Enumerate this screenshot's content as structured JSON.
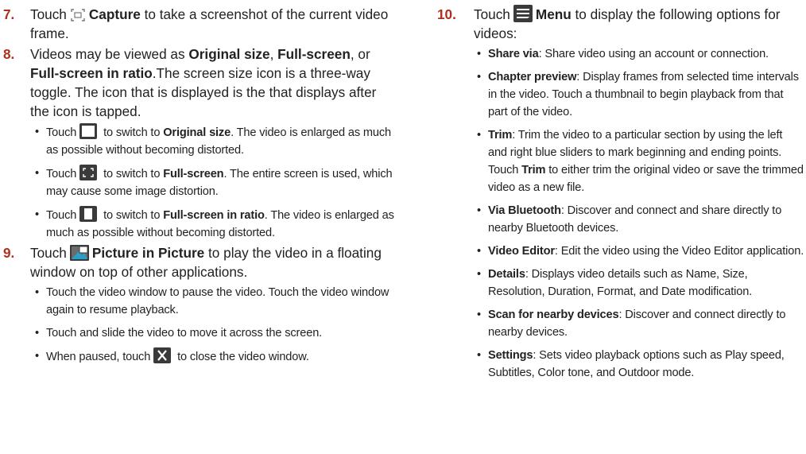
{
  "left": {
    "step7": {
      "num": "7.",
      "pre": "Touch",
      "icon": "capture-icon",
      "bold": "Capture",
      "post": " to take a screenshot of the current video frame."
    },
    "step8": {
      "num": "8.",
      "t1": "Videos may be viewed as ",
      "b1": "Original size",
      "t2": ", ",
      "b2": "Full-screen",
      "t3": ", or ",
      "b3": "Full-screen in ratio",
      "t4": ".The screen size icon is a three-way toggle. The icon that is displayed is the that displays after the icon is tapped.",
      "bullets": [
        {
          "pre": "Touch",
          "icon": "original-size-icon",
          "mid": " to switch to ",
          "bold": "Original size",
          "post": ". The video is enlarged as much as possible without becoming distorted."
        },
        {
          "pre": "Touch",
          "icon": "full-screen-icon",
          "mid": " to switch to ",
          "bold": "Full-screen",
          "post": ". The entire screen is used, which may cause some image distortion."
        },
        {
          "pre": "Touch",
          "icon": "full-screen-ratio-icon",
          "mid": " to switch to ",
          "bold": "Full-screen in ratio",
          "post": ". The video is enlarged as much as possible without becoming distorted."
        }
      ]
    },
    "step9": {
      "num": "9.",
      "pre": "Touch",
      "icon": "picture-in-picture-icon",
      "bold": "Picture in Picture",
      "post": " to play the video in a floating window on top of other applications.",
      "bullets": [
        "Touch the video window to pause the video. Touch the video window again to resume playback.",
        "Touch and slide the video to move it across the screen."
      ],
      "last_bullet": {
        "pre": "When paused, touch",
        "icon": "close-icon",
        "post": " to close the video window."
      }
    }
  },
  "right": {
    "step10": {
      "num": "10.",
      "pre": "Touch",
      "icon": "menu-icon",
      "bold": "Menu",
      "post": " to display the following options for videos:",
      "options": [
        {
          "bold": "Share via",
          "text": ": Share video using an account or connection."
        },
        {
          "bold": "Chapter preview",
          "text": ": Display frames from selected time intervals in the video. Touch a thumbnail to begin playback from that part of the video."
        },
        {
          "bold": "Trim",
          "text": ": Trim the video to a particular section by using the left and right blue sliders to mark beginning and ending points. Touch ",
          "bold2": "Trim",
          "text2": " to either trim the original video or save the trimmed video as a new file."
        },
        {
          "bold": "Via Bluetooth",
          "text": ": Discover and connect and share directly to nearby Bluetooth devices."
        },
        {
          "bold": "Video Editor",
          "text": ": Edit the video using the Video Editor application."
        },
        {
          "bold": "Details",
          "text": ": Displays video details such as Name, Size, Resolution, Duration, Format, and Date modification."
        },
        {
          "bold": "Scan for nearby devices",
          "text": ": Discover and connect directly to nearby devices."
        },
        {
          "bold": "Settings",
          "text": ": Sets video playback options such as Play speed, Subtitles, Color tone, and Outdoor mode."
        }
      ]
    }
  },
  "colors": {
    "step_number": "#b0301e",
    "text": "#222222",
    "icon_dark": "#3a3a3a"
  }
}
